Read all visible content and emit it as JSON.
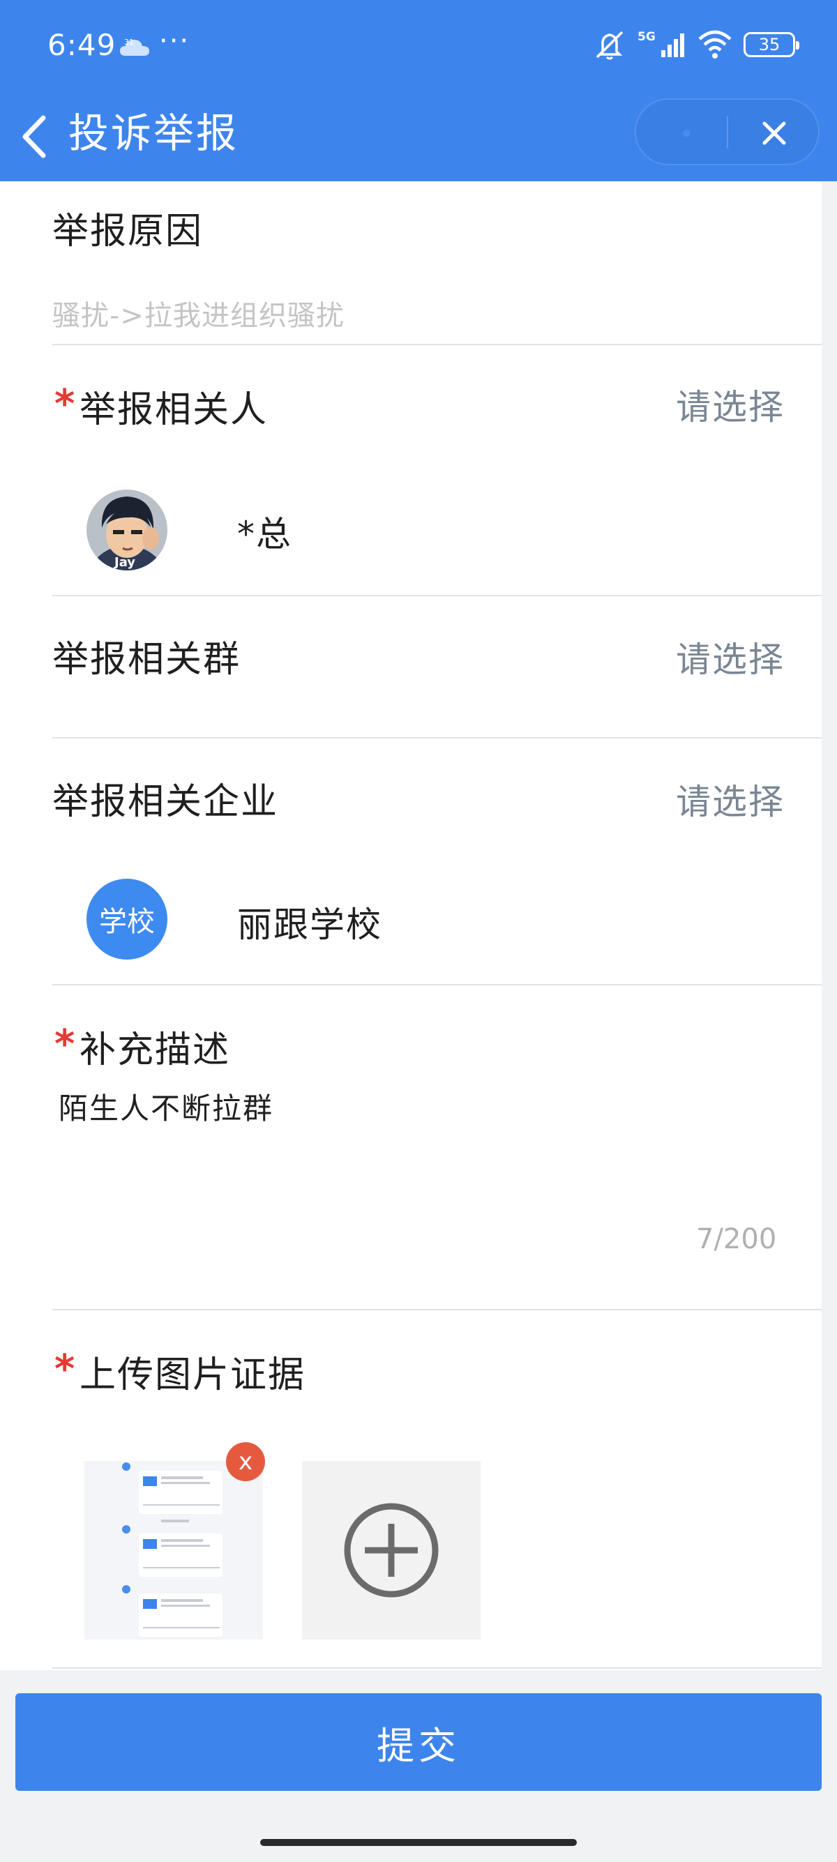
{
  "status_bar": {
    "time": "6:49",
    "weather_temp": "31",
    "more": "···",
    "network": "5G",
    "battery": "35"
  },
  "nav": {
    "title": "投诉举报"
  },
  "form": {
    "reason": {
      "label": "举报原因",
      "value": "骚扰->拉我进组织骚扰"
    },
    "person": {
      "required_mark": "*",
      "label": "举报相关人",
      "action": "请选择",
      "selected_name": "*总",
      "avatar_caption": "Jay"
    },
    "group": {
      "label": "举报相关群",
      "action": "请选择"
    },
    "company": {
      "label": "举报相关企业",
      "action": "请选择",
      "avatar_text": "学校",
      "selected_name": "丽跟学校"
    },
    "description": {
      "required_mark": "*",
      "label": "补充描述",
      "value": "陌生人不断拉群",
      "counter": "7/200"
    },
    "evidence": {
      "required_mark": "*",
      "label": "上传图片证据",
      "delete_label": "x"
    }
  },
  "submit_label": "提交",
  "colors": {
    "primary": "#3d85ec",
    "required": "#e53935",
    "delete_badge": "#e55a3f"
  }
}
